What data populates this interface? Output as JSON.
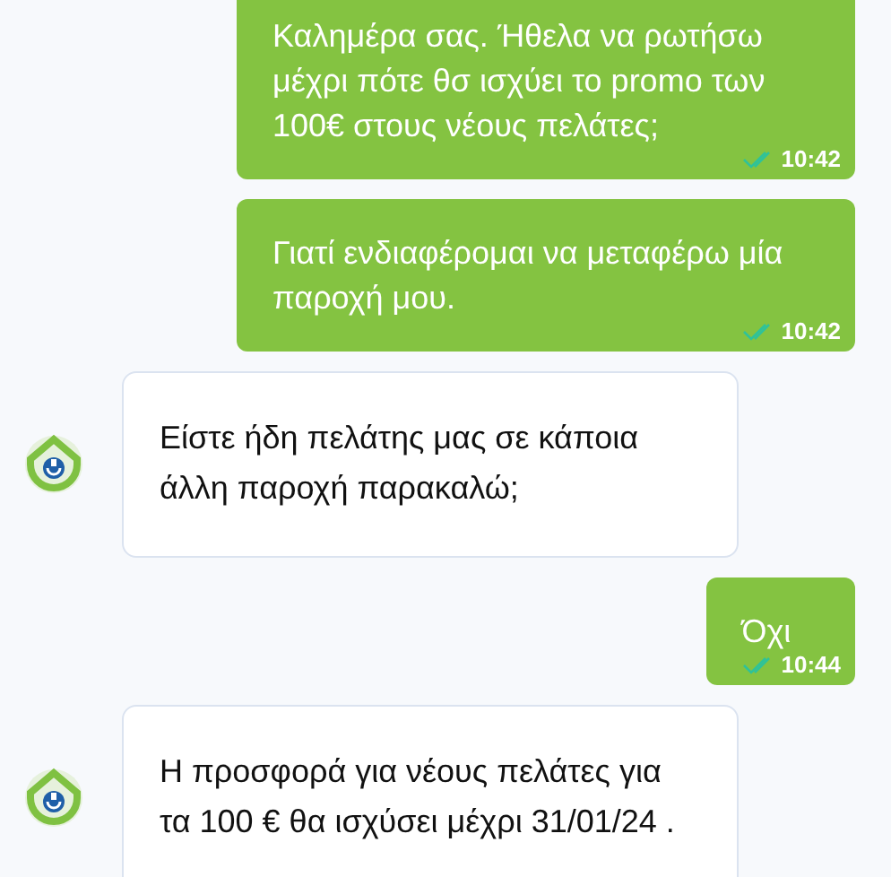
{
  "messages": [
    {
      "kind": "sent",
      "text": "Καλημέρα σας. Ήθελα να ρωτήσω μέχρι πότε θσ ισχύει το promo των 100€ στους νέους πελάτες;",
      "time": "10:42"
    },
    {
      "kind": "sent",
      "text": "Γιατί ενδιαφέρομαι να μεταφέρω μία παροχή μου.",
      "time": "10:42"
    },
    {
      "kind": "received",
      "text": "Είστε ήδη πελάτης μας σε κάποια άλλη παροχή παρακαλώ;"
    },
    {
      "kind": "sent",
      "text": "Όχι",
      "time": "10:44"
    },
    {
      "kind": "received",
      "text": "Η προσφορά για νέους πελάτες για τα 100 € θα ισχύσει μέχρι 31/01/24 ."
    }
  ]
}
